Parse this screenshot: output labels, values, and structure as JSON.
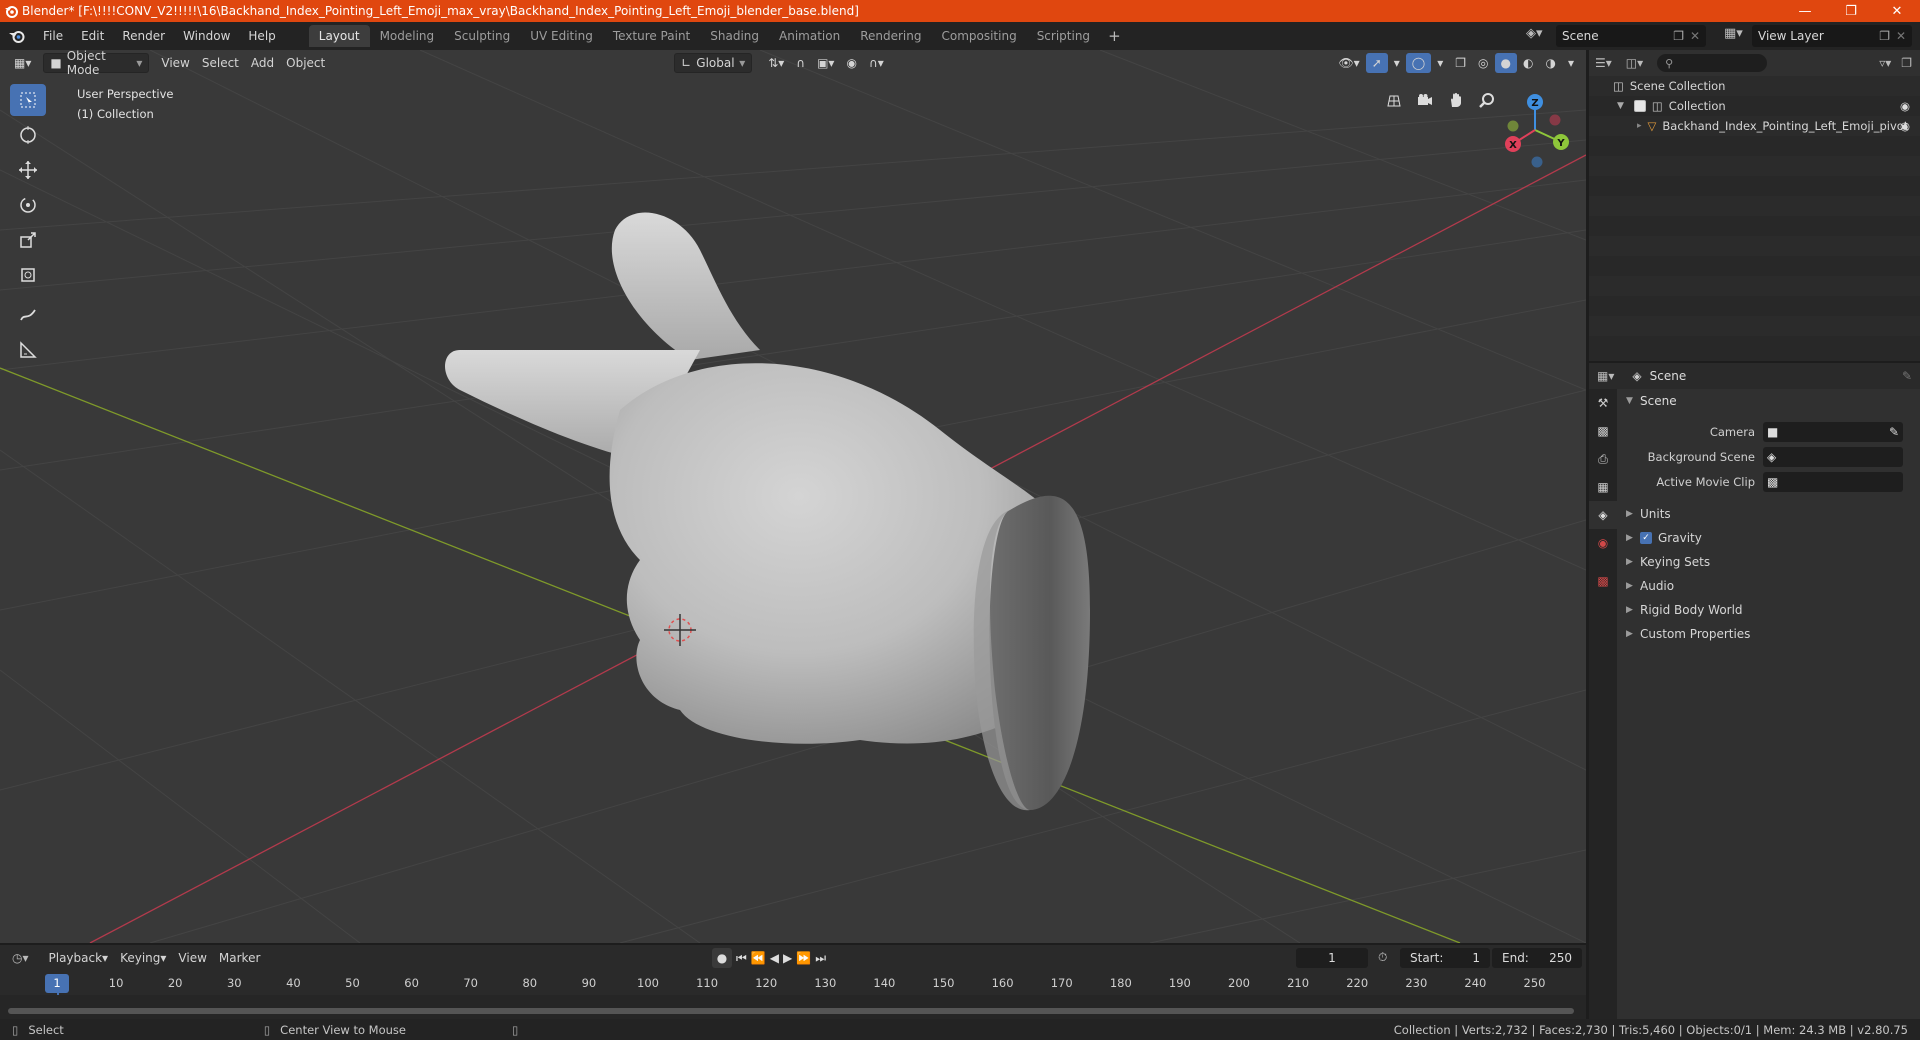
{
  "window": {
    "title": "Blender* [F:\\!!!!CONV_V2!!!!!\\16\\Backhand_Index_Pointing_Left_Emoji_max_vray\\Backhand_Index_Pointing_Left_Emoji_blender_base.blend]"
  },
  "menu": [
    "File",
    "Edit",
    "Render",
    "Window",
    "Help"
  ],
  "workspaces": [
    "Layout",
    "Modeling",
    "Sculpting",
    "UV Editing",
    "Texture Paint",
    "Shading",
    "Animation",
    "Rendering",
    "Compositing",
    "Scripting"
  ],
  "active_workspace": "Layout",
  "scene_selector": "Scene",
  "view_layer_selector": "View Layer",
  "viewport": {
    "mode": "Object Mode",
    "menus": [
      "View",
      "Select",
      "Add",
      "Object"
    ],
    "transform_orientation": "Global",
    "perspective_label": "User Perspective",
    "collection_label": "(1) Collection",
    "gizmo_axes": {
      "z": "Z",
      "y": "Y",
      "x": "X"
    }
  },
  "outliner": {
    "rows": [
      "Scene Collection",
      "Collection",
      "Backhand_Index_Pointing_Left_Emoji_pivot"
    ]
  },
  "properties": {
    "header": "Scene",
    "panel": "Scene",
    "fields": [
      {
        "label": "Camera"
      },
      {
        "label": "Background Scene"
      },
      {
        "label": "Active Movie Clip"
      }
    ],
    "subpanels": [
      "Units",
      "Gravity",
      "Keying Sets",
      "Audio",
      "Rigid Body World",
      "Custom Properties"
    ]
  },
  "timeline": {
    "menus": [
      "Playback",
      "Keying",
      "View",
      "Marker"
    ],
    "current_frame": "1",
    "start_label": "Start:",
    "start": "1",
    "end_label": "End:",
    "end": "250",
    "ruler": [
      "1",
      "10",
      "20",
      "30",
      "40",
      "50",
      "60",
      "70",
      "80",
      "90",
      "100",
      "110",
      "120",
      "130",
      "140",
      "150",
      "160",
      "170",
      "180",
      "190",
      "200",
      "210",
      "220",
      "230",
      "240",
      "250"
    ]
  },
  "statusbar": {
    "left": "Select",
    "middle": "Center View to Mouse",
    "right": "Collection | Verts:2,732 | Faces:2,730 | Tris:5,460 | Objects:0/1 | Mem: 24.3 MB | v2.80.75"
  },
  "colors": {
    "titlebar": "#e0470f",
    "accent": "#4772b3",
    "x_axis": "#e0405a",
    "y_axis": "#8ec63a",
    "z_axis": "#3f8fe0"
  }
}
